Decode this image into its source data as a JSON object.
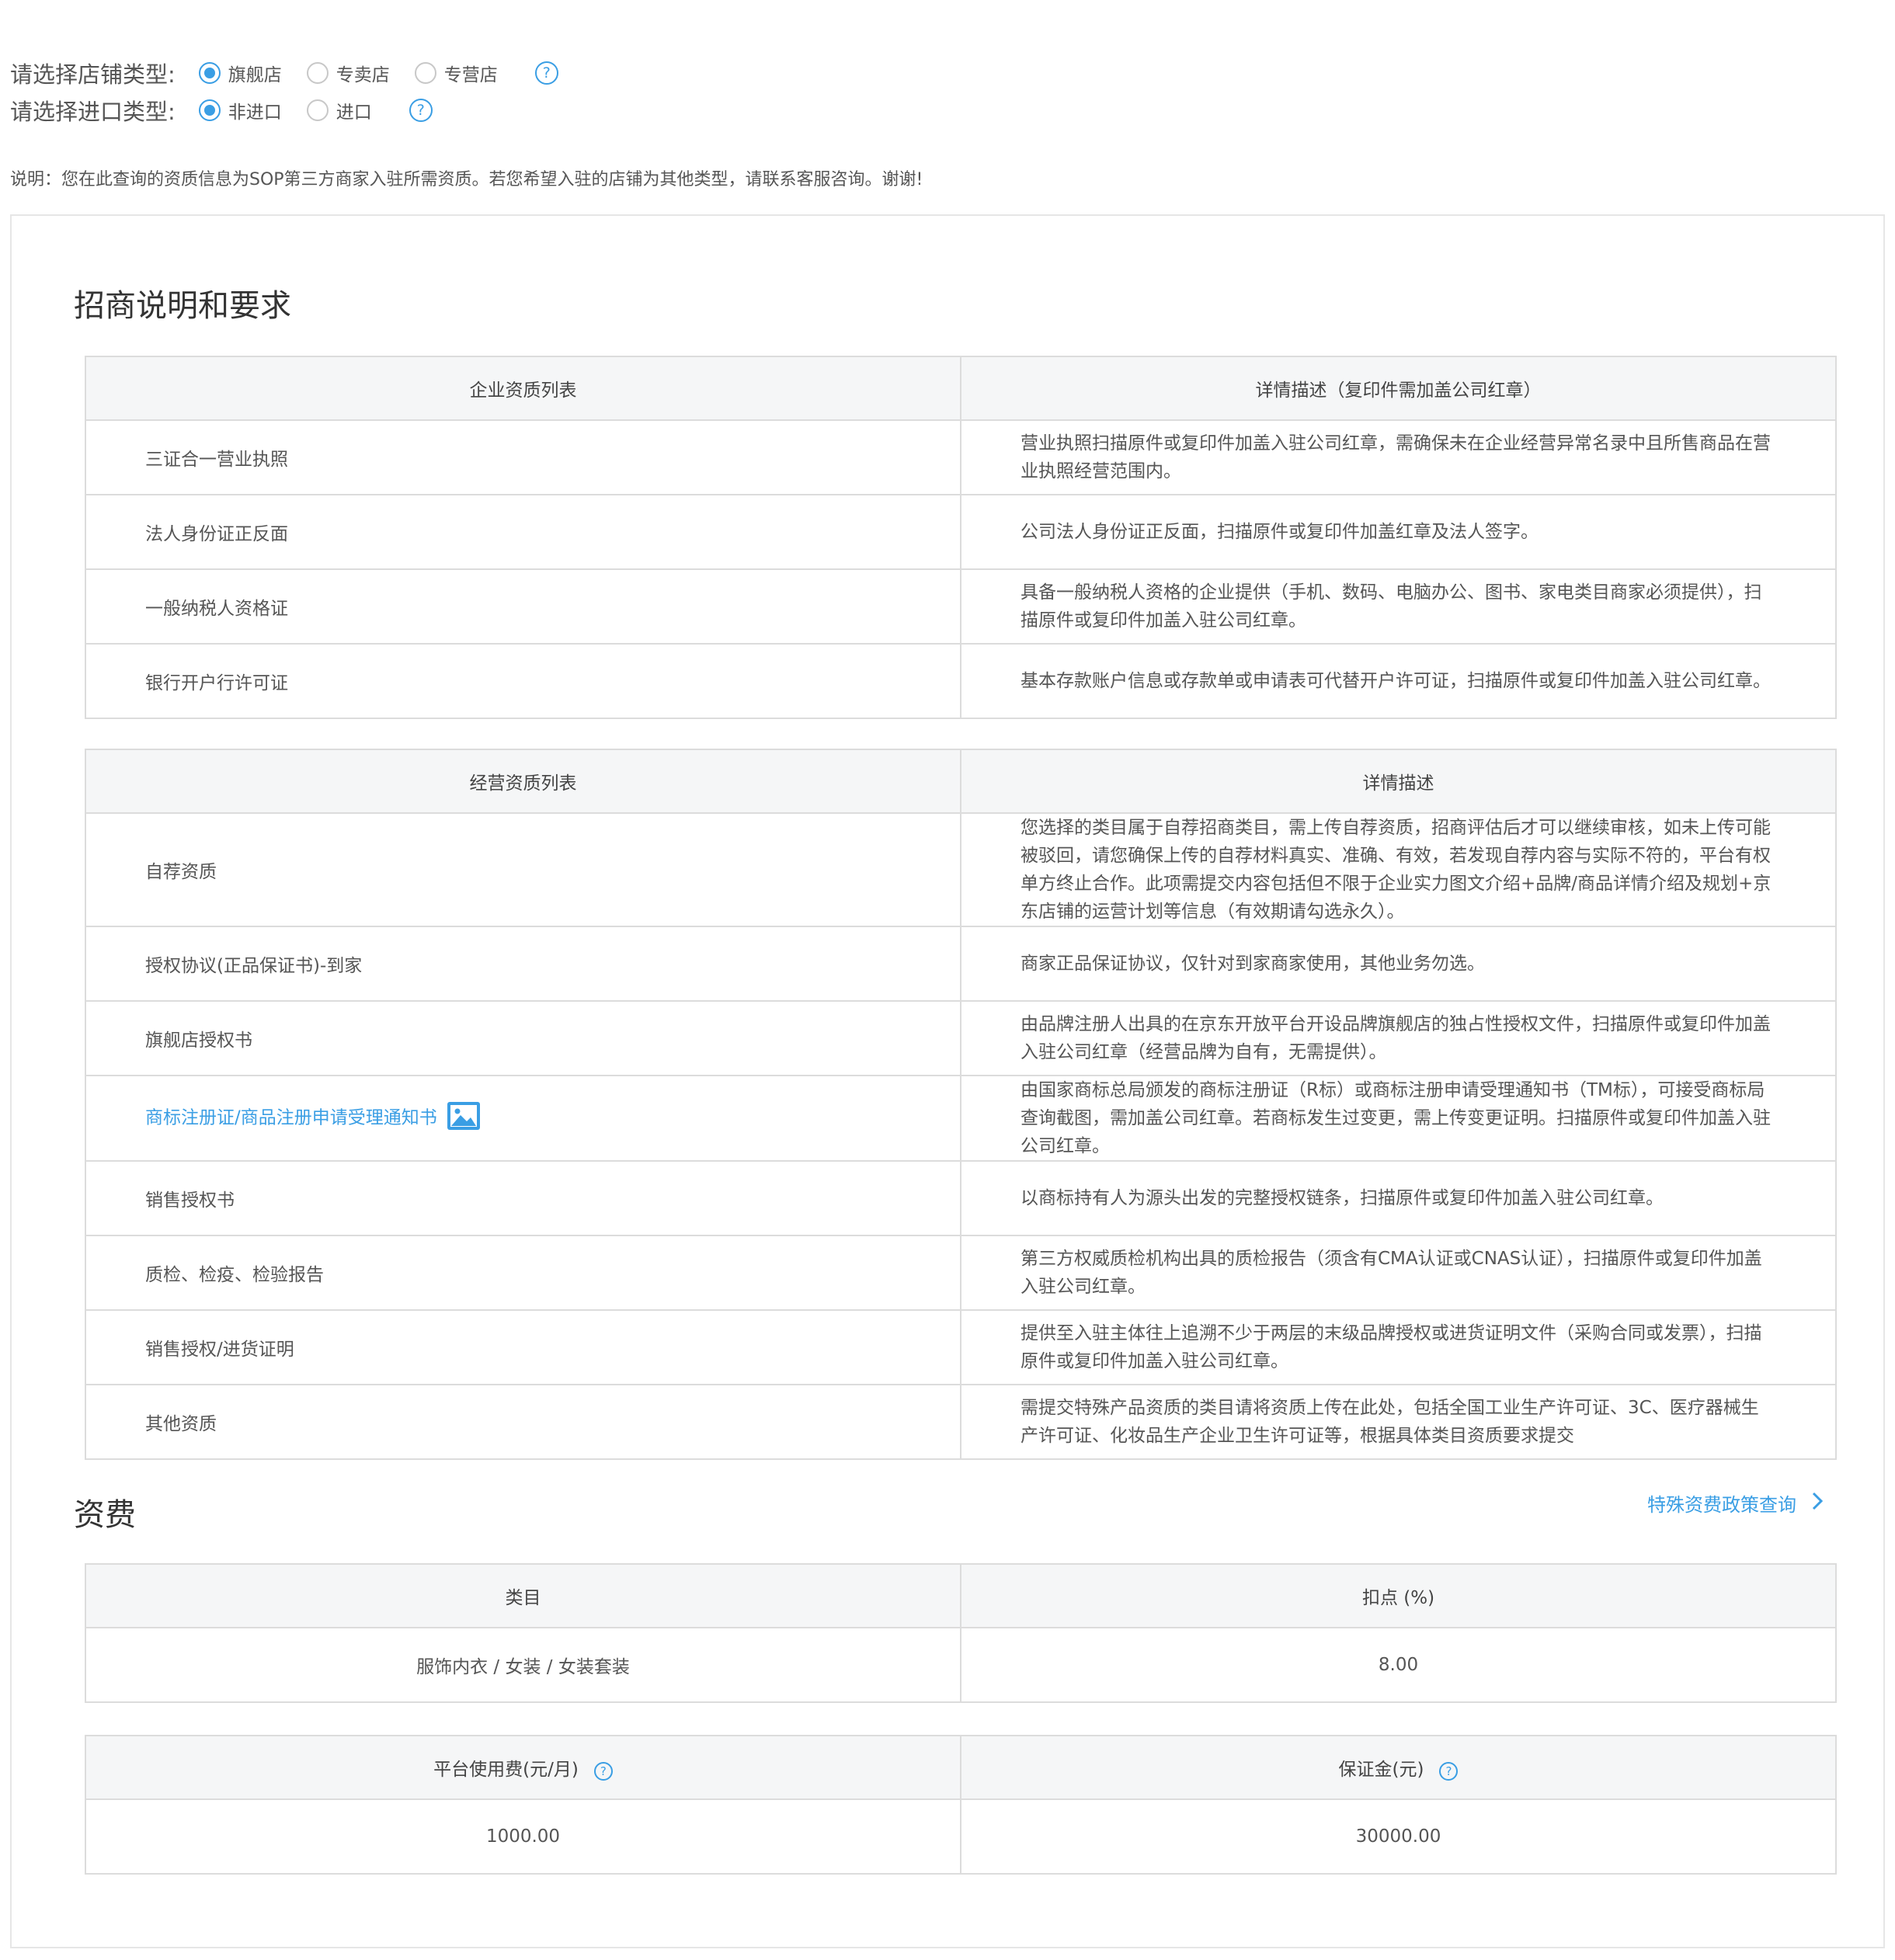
{
  "store_type": {
    "label": "请选择店铺类型:",
    "options": [
      "旗舰店",
      "专卖店",
      "专营店"
    ],
    "selected": "旗舰店"
  },
  "import_type": {
    "label": "请选择进口类型:",
    "options": [
      "非进口",
      "进口"
    ],
    "selected": "非进口"
  },
  "help_icon": "?",
  "notice": "说明：您在此查询的资质信息为SOP第三方商家入驻所需资质。若您希望入驻的店铺为其他类型，请联系客服咨询。谢谢!",
  "requirements": {
    "title": "招商说明和要求",
    "company_table": {
      "headers": [
        "企业资质列表",
        "详情描述（复印件需加盖公司红章）"
      ],
      "rows": [
        {
          "name": "三证合一营业执照",
          "desc": [
            "营业执照扫描原件或复印件加盖入驻公司红章，需确保未在企业经营异常名录中且所售商品在营",
            "业执照经营范围内。"
          ]
        },
        {
          "name": "法人身份证正反面",
          "desc": [
            "公司法人身份证正反面，扫描原件或复印件加盖红章及法人签字。"
          ]
        },
        {
          "name": "一般纳税人资格证",
          "desc": [
            "具备一般纳税人资格的企业提供（手机、数码、电脑办公、图书、家电类目商家必须提供），扫",
            "描原件或复印件加盖入驻公司红章。"
          ]
        },
        {
          "name": "银行开户行许可证",
          "desc": [
            "基本存款账户信息或存款单或申请表可代替开户许可证，扫描原件或复印件加盖入驻公司红章。"
          ]
        }
      ]
    },
    "business_table": {
      "headers": [
        "经营资质列表",
        "详情描述"
      ],
      "rows": [
        {
          "name": "自荐资质",
          "desc": [
            "您选择的类目属于自荐招商类目，需上传自荐资质，招商评估后才可以继续审核，如未上传可能",
            "被驳回，请您确保上传的自荐材料真实、准确、有效，若发现自荐内容与实际不符的，平台有权",
            "单方终止合作。此项需提交内容包括但不限于企业实力图文介绍+品牌/商品详情介绍及规划+京",
            "东店铺的运营计划等信息（有效期请勾选永久）。"
          ]
        },
        {
          "name": "授权协议(正品保证书)-到家",
          "desc": [
            "商家正品保证协议，仅针对到家商家使用，其他业务勿选。"
          ]
        },
        {
          "name": "旗舰店授权书",
          "desc": [
            "由品牌注册人出具的在京东开放平台开设品牌旗舰店的独占性授权文件，扫描原件或复印件加盖",
            "入驻公司红章（经营品牌为自有，无需提供）。"
          ]
        },
        {
          "name": "商标注册证/商品注册申请受理通知书",
          "link": true,
          "desc": [
            "由国家商标总局颁发的商标注册证（R标）或商标注册申请受理通知书（TM标），可接受商标局",
            "查询截图，需加盖公司红章。若商标发生过变更，需上传变更证明。扫描原件或复印件加盖入驻",
            "公司红章。"
          ]
        },
        {
          "name": "销售授权书",
          "desc": [
            "以商标持有人为源头出发的完整授权链条，扫描原件或复印件加盖入驻公司红章。"
          ]
        },
        {
          "name": "质检、检疫、检验报告",
          "desc": [
            "第三方权威质检机构出具的质检报告（须含有CMA认证或CNAS认证），扫描原件或复印件加盖",
            "入驻公司红章。"
          ]
        },
        {
          "name": "销售授权/进货证明",
          "desc": [
            "提供至入驻主体往上追溯不少于两层的末级品牌授权或进货证明文件（采购合同或发票），扫描",
            "原件或复印件加盖入驻公司红章。"
          ]
        },
        {
          "name": "其他资质",
          "desc": [
            "需提交特殊产品资质的类目请将资质上传在此处，包括全国工业生产许可证、3C、医疗器械生",
            "产许可证、化妆品生产企业卫生许可证等，根据具体类目资质要求提交"
          ]
        }
      ]
    }
  },
  "fees": {
    "title": "资费",
    "policy_link": "特殊资费政策查询",
    "commission_table": {
      "headers": [
        "类目",
        "扣点 (%)"
      ],
      "rows": [
        [
          "服饰内衣 / 女装 / 女装套装",
          "8.00"
        ]
      ]
    },
    "platform_table": {
      "headers": [
        "平台使用费(元/月)",
        "保证金(元)"
      ],
      "rows": [
        [
          "1000.00",
          "30000.00"
        ]
      ]
    }
  },
  "colors": {
    "accent": "#3a9ee4",
    "header_bg": "#f5f6f7",
    "border": "#dcdcdc"
  }
}
